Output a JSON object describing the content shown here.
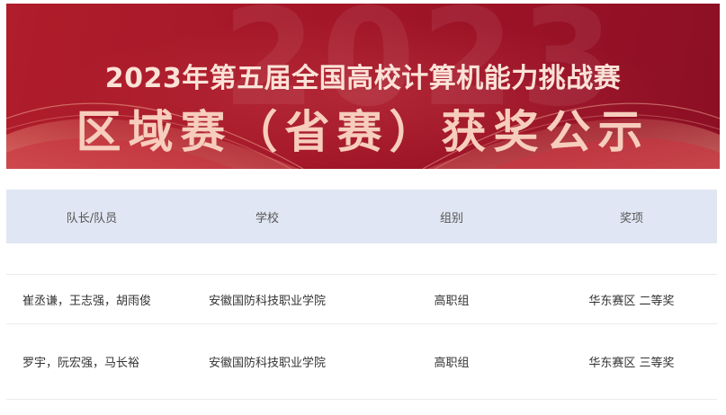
{
  "banner": {
    "watermark": "2023",
    "title_line1": "2023年第五届全国高校计算机能力挑战赛",
    "title_line2": "区域赛（省赛）获奖公示"
  },
  "table": {
    "headers": [
      "队长/队员",
      "学校",
      "组别",
      "奖项"
    ],
    "rows": [
      {
        "members": "崔丞谦，王志强，胡雨俊",
        "school": "安徽国防科技职业学院",
        "group": "高职组",
        "award": "华东赛区 二等奖"
      },
      {
        "members": "罗宇，阮宏强，马长裕",
        "school": "安徽国防科技职业学院",
        "group": "高职组",
        "award": "华东赛区 三等奖"
      }
    ]
  },
  "colors": {
    "banner_red": "#a21628",
    "header_bg": "#e0e6f3",
    "title_text": "#fbe2d7"
  }
}
